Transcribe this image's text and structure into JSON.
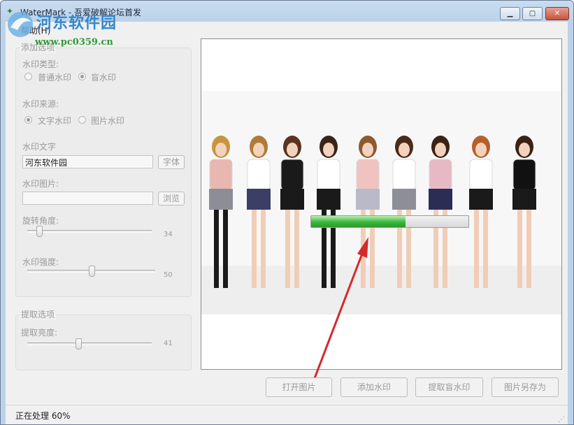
{
  "window": {
    "title": "WaterMark - 吾爱破解论坛首发",
    "watermark_logo_text": "河东软件园",
    "watermark_logo_url": "www.pc0359.cn",
    "min_glyph": "▁",
    "max_glyph": "▢",
    "close_glyph": "✕"
  },
  "menu": {
    "help": "帮助(H)"
  },
  "add_options": {
    "group_title": "添加选项",
    "type_label": "水印类型:",
    "type_options": [
      "普通水印",
      "盲水印"
    ],
    "type_selected": "盲水印",
    "source_label": "水印来源:",
    "source_options": [
      "文字水印",
      "图片水印"
    ],
    "source_selected": "文字水印",
    "text_label": "水印文字",
    "text_value": "河东软件园",
    "font_button": "字体",
    "image_label": "水印图片:",
    "image_value": "",
    "browse_button": "浏览",
    "rotate_label": "旋转角度:",
    "rotate_value": 34,
    "rotate_max": 360,
    "strength_label": "水印强度:",
    "strength_value": 50,
    "strength_max": 100
  },
  "extract_options": {
    "group_title": "提取选项",
    "brightness_label": "提取亮度:",
    "brightness_value": 41,
    "brightness_max": 100
  },
  "progress": {
    "percent": 60
  },
  "buttons": {
    "open": "打开图片",
    "add": "添加水印",
    "extract": "提取盲水印",
    "save_as": "图片另存为"
  },
  "status": {
    "text": "正在处理 60%"
  },
  "colors": {
    "progress_green": "#39b53a",
    "arrow_red": "#d42a2a",
    "logo_blue": "#2d83c8",
    "logo_green": "#2f9a33"
  }
}
